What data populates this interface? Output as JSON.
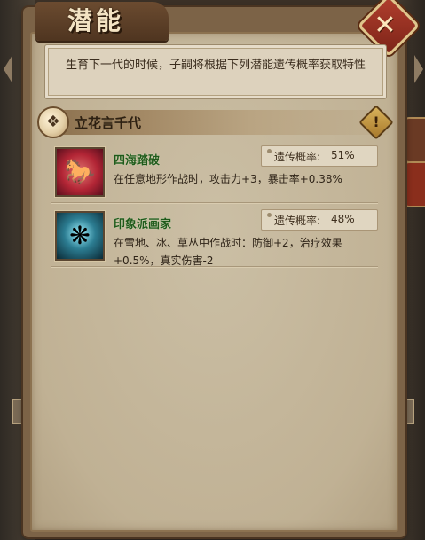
{
  "panel": {
    "title": "潜能",
    "intro": "生育下一代的时候，子嗣将根据下列潜能遗传概率获取特性"
  },
  "lineage": {
    "name": "立花言千代"
  },
  "traits": [
    {
      "name": "四海踏破",
      "chance_label": "遗传概率:",
      "chance_value": "51%",
      "description": "在任意地形作战时，攻击力+3，暴击率+0.38%"
    },
    {
      "name": "印象派画家",
      "chance_label": "遗传概率:",
      "chance_value": "48%",
      "description": "在雪地、冰、草丛中作战时：防御+2，治疗效果+0.5%，真实伤害-2"
    }
  ],
  "icons": {
    "close": "close-icon",
    "lineage": "lineage-emblem-icon",
    "alert": "exclamation-icon",
    "trait1": "horse-rider-icon",
    "trait2": "butterfly-face-icon"
  },
  "colors": {
    "trait_name": "#1f5a1a",
    "panel_bg": "#c6b89d",
    "frame": "#7c6347",
    "close_red": "#b03e2d"
  }
}
